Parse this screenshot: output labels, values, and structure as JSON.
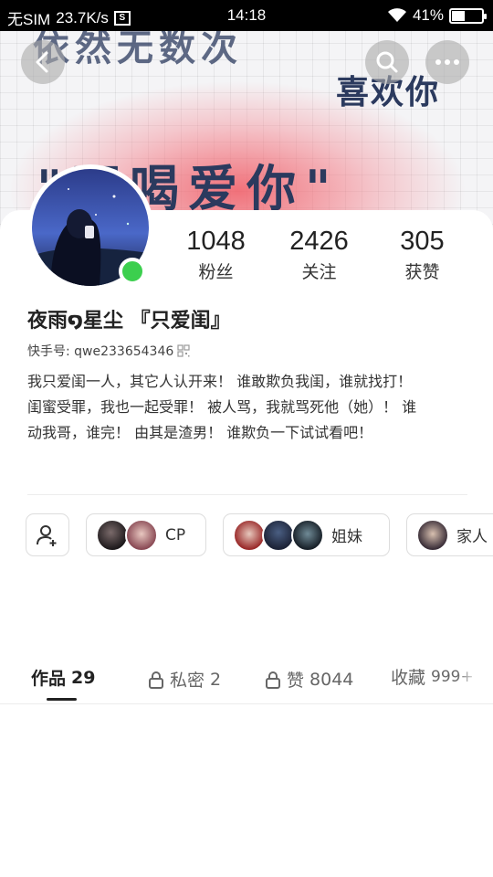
{
  "status_bar": {
    "carrier": "无SIM",
    "speed": "23.7K/s",
    "time": "14:18",
    "battery": "41%",
    "battery_level": 0.41
  },
  "cover": {
    "line1": "依然无数次",
    "line2": "喜欢你",
    "line3": "\"再喝爱你\""
  },
  "profile": {
    "stats": [
      {
        "value": "1048",
        "label": "粉丝"
      },
      {
        "value": "2426",
        "label": "关注"
      },
      {
        "value": "305",
        "label": "获赞"
      }
    ],
    "nickname": "夜雨໑星尘 『只爱闺』",
    "kuaishou_id": "快手号: qwe233654346",
    "bio_lines": [
      "我只爱闺一人，其它人认开来！ 谁敢欺负我闺，谁就找打！",
      "闺蜜受罪，我也一起受罪！ 被人骂，我就骂死他（她）！ 谁",
      "动我哥，谁完！ 由其是渣男！ 谁欺负一下试试看吧！"
    ],
    "online": true
  },
  "relations": [
    {
      "label": "CP"
    },
    {
      "label": "姐妹"
    },
    {
      "label": "家人"
    }
  ],
  "tabs": [
    {
      "label": "作品",
      "count": "29",
      "active": true
    },
    {
      "label": "私密",
      "count": "2",
      "locked": true
    },
    {
      "label": "赞",
      "count": "8044",
      "locked": true
    },
    {
      "label": "收藏",
      "count": "999+"
    }
  ],
  "colors": {
    "online": "#3ccf4e",
    "cover_text": "#2b3a5e"
  }
}
